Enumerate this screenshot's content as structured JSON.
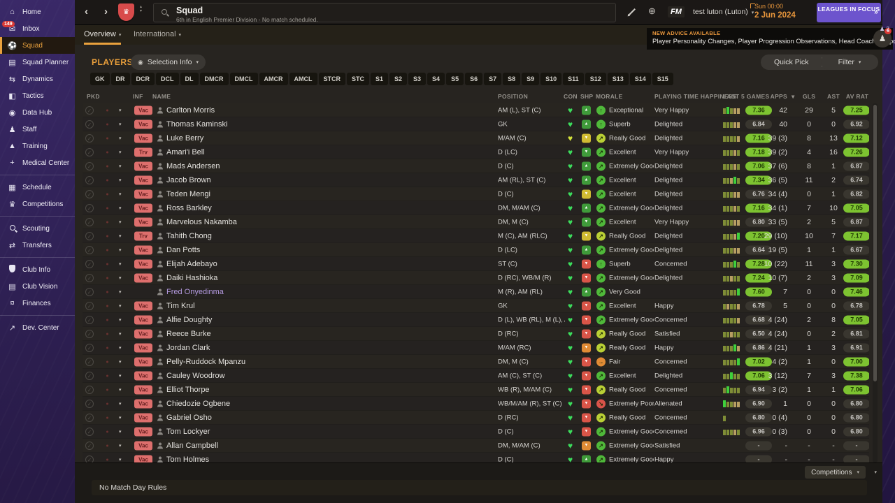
{
  "colors": {
    "accent_orange": "#e9a13d",
    "good_green": "#7dc331",
    "vac_red": "#de6f6d",
    "purple": "#6d54cd"
  },
  "sidebar": {
    "items": [
      {
        "label": "Home",
        "icon": "home-icon"
      },
      {
        "label": "Inbox",
        "icon": "inbox-icon",
        "badge": "149"
      },
      {
        "label": "Squad",
        "icon": "shirt-icon",
        "selected": true
      },
      {
        "label": "Squad Planner",
        "icon": "clipboard-icon"
      },
      {
        "label": "Dynamics",
        "icon": "dynamics-icon"
      },
      {
        "label": "Tactics",
        "icon": "tactics-icon"
      },
      {
        "label": "Data Hub",
        "icon": "data-hub-icon"
      },
      {
        "label": "Staff",
        "icon": "staff-icon"
      },
      {
        "label": "Training",
        "icon": "training-icon"
      },
      {
        "label": "Medical Center",
        "icon": "medical-icon"
      },
      {
        "label": "Schedule",
        "icon": "calendar-icon",
        "group_start": true
      },
      {
        "label": "Competitions",
        "icon": "trophy-icon"
      },
      {
        "label": "Scouting",
        "icon": "scouting-icon",
        "group_start": true
      },
      {
        "label": "Transfers",
        "icon": "transfers-icon"
      },
      {
        "label": "Club Info",
        "icon": "shield-icon",
        "group_start": true
      },
      {
        "label": "Club Vision",
        "icon": "briefcase-icon"
      },
      {
        "label": "Finances",
        "icon": "finances-icon"
      },
      {
        "label": "Dev. Center",
        "icon": "dev-center-icon",
        "group_start": true
      }
    ]
  },
  "topbar": {
    "title": "Squad",
    "subtitle": "6th in English Premier Division - No match scheduled.",
    "fm_label": "FM",
    "manager": "test luton (Luton)",
    "clock": "Sun 00:00",
    "date": "2 Jun 2024",
    "leagues_button": "LEAGUES IN FOCUS",
    "focus_count": "2"
  },
  "tabs": [
    {
      "label": "Overview"
    },
    {
      "label": "International"
    }
  ],
  "advice": {
    "headline": "NEW ADVICE AVAILABLE",
    "items": "Player Personality Changes, Player Progression Observations, Head Coach Support",
    "badge": "5"
  },
  "players_panel": {
    "title": "PLAYERS",
    "selection_info": "Selection Info",
    "quick_pick": "Quick Pick",
    "filter": "Filter",
    "position_filters": [
      "GK",
      "DR",
      "DCR",
      "DCL",
      "DL",
      "DMCR",
      "DMCL",
      "AMCR",
      "AMCL",
      "STCR",
      "STC",
      "S1",
      "S2",
      "S3",
      "S4",
      "S5",
      "S6",
      "S7",
      "S8",
      "S9",
      "S10",
      "S11",
      "S12",
      "S13",
      "S14",
      "S15"
    ]
  },
  "table": {
    "headers": {
      "pkd": "PKD",
      "inf": "INF",
      "name": "NAME",
      "position": "POSITION",
      "con": "CON",
      "shp": "SHP",
      "morale": "MORALE",
      "pth": "PLAYING TIME HAPPINESS",
      "last5": "LAST 5 GAMES",
      "apps": "APPS",
      "gls": "GLS",
      "ast": "AST",
      "avrat": "AV RAT"
    },
    "rows": [
      {
        "name": "Carlton Morris",
        "status": "Vac",
        "pos": "AM (L), ST (C)",
        "con": "green",
        "shp": {
          "c": "green",
          "d": "up"
        },
        "morale": {
          "label": "Exceptional",
          "color": "green",
          "arrow": "up"
        },
        "pth": "Very Happy",
        "bars": [
          "o",
          "g",
          "o",
          "t",
          "t"
        ],
        "r5": "7.36",
        "r5good": true,
        "apps": "42",
        "gls": "29",
        "ast": "5",
        "avrat": "7.25",
        "avgood": true
      },
      {
        "name": "Thomas Kaminski",
        "status": "Vac",
        "pos": "GK",
        "con": "green",
        "shp": {
          "c": "green",
          "d": "up"
        },
        "morale": {
          "label": "Superb",
          "color": "green",
          "arrow": "up"
        },
        "pth": "Delighted",
        "bars": [
          "o",
          "o",
          "o",
          "t",
          "t"
        ],
        "r5": "6.84",
        "r5good": false,
        "apps": "40",
        "gls": "0",
        "ast": "0",
        "avrat": "6.92",
        "avgood": false
      },
      {
        "name": "Luke Berry",
        "status": "Vac",
        "pos": "M/AM (C)",
        "con": "yellow",
        "shp": {
          "c": "yellow",
          "d": "down"
        },
        "morale": {
          "label": "Really Good",
          "color": "lime",
          "arrow": "ne"
        },
        "pth": "Delighted",
        "bars": [
          "o",
          "o",
          "o",
          "o",
          "t"
        ],
        "r5": "7.16",
        "r5good": true,
        "apps": "39 (3)",
        "gls": "8",
        "ast": "13",
        "avrat": "7.12",
        "avgood": true
      },
      {
        "name": "Amari'i Bell",
        "status": "Trv",
        "pos": "D (LC)",
        "con": "green",
        "shp": {
          "c": "green",
          "d": "down"
        },
        "morale": {
          "label": "Excellent",
          "color": "green",
          "arrow": "ne"
        },
        "pth": "Very Happy",
        "bars": [
          "o",
          "o",
          "o",
          "t",
          "o"
        ],
        "r5": "7.18",
        "r5good": true,
        "apps": "39 (2)",
        "gls": "4",
        "ast": "16",
        "avrat": "7.26",
        "avgood": true
      },
      {
        "name": "Mads Andersen",
        "status": "Vac",
        "pos": "D (C)",
        "con": "green",
        "shp": {
          "c": "green",
          "d": "up"
        },
        "morale": {
          "label": "Extremely Good",
          "color": "green",
          "arrow": "ne"
        },
        "pth": "Delighted",
        "bars": [
          "o",
          "o",
          "o",
          "t",
          "o"
        ],
        "r5": "7.06",
        "r5good": true,
        "apps": "37 (6)",
        "gls": "8",
        "ast": "1",
        "avrat": "6.87",
        "avgood": false
      },
      {
        "name": "Jacob Brown",
        "status": "Vac",
        "pos": "AM (RL), ST (C)",
        "con": "green",
        "shp": {
          "c": "green",
          "d": "up"
        },
        "morale": {
          "label": "Excellent",
          "color": "green",
          "arrow": "ne"
        },
        "pth": "Delighted",
        "bars": [
          "o",
          "o",
          "t",
          "g",
          "o"
        ],
        "r5": "7.34",
        "r5good": true,
        "apps": "36 (5)",
        "gls": "11",
        "ast": "2",
        "avrat": "6.74",
        "avgood": false
      },
      {
        "name": "Teden Mengi",
        "status": "Vac",
        "pos": "D (C)",
        "con": "green",
        "shp": {
          "c": "yellow",
          "d": "down"
        },
        "morale": {
          "label": "Excellent",
          "color": "green",
          "arrow": "ne"
        },
        "pth": "Delighted",
        "bars": [
          "o",
          "o",
          "o",
          "t",
          "t"
        ],
        "r5": "6.76",
        "r5good": false,
        "apps": "34 (4)",
        "gls": "0",
        "ast": "1",
        "avrat": "6.82",
        "avgood": false
      },
      {
        "name": "Ross Barkley",
        "status": "Vac",
        "pos": "DM, M/AM (C)",
        "con": "green",
        "shp": {
          "c": "green",
          "d": "up"
        },
        "morale": {
          "label": "Extremely Good",
          "color": "green",
          "arrow": "ne"
        },
        "pth": "Delighted",
        "bars": [
          "o",
          "o",
          "o",
          "t",
          "o"
        ],
        "r5": "7.16",
        "r5good": true,
        "apps": "34 (1)",
        "gls": "7",
        "ast": "10",
        "avrat": "7.05",
        "avgood": true
      },
      {
        "name": "Marvelous Nakamba",
        "status": "Vac",
        "pos": "DM, M (C)",
        "con": "green",
        "shp": {
          "c": "green",
          "d": "down"
        },
        "morale": {
          "label": "Excellent",
          "color": "green",
          "arrow": "ne"
        },
        "pth": "Very Happy",
        "bars": [
          "o",
          "o",
          "o",
          "t",
          "t"
        ],
        "r5": "6.80",
        "r5good": false,
        "apps": "33 (5)",
        "gls": "2",
        "ast": "5",
        "avrat": "6.87",
        "avgood": false
      },
      {
        "name": "Tahith Chong",
        "status": "Trv",
        "pos": "M (C), AM (RLC)",
        "con": "green",
        "shp": {
          "c": "yellow",
          "d": "down"
        },
        "morale": {
          "label": "Really Good",
          "color": "lime",
          "arrow": "ne"
        },
        "pth": "Delighted",
        "bars": [
          "o",
          "o",
          "o",
          "t",
          "g"
        ],
        "r5": "7.20",
        "r5good": true,
        "apps": "29 (10)",
        "gls": "10",
        "ast": "7",
        "avrat": "7.17",
        "avgood": true
      },
      {
        "name": "Dan Potts",
        "status": "Vac",
        "pos": "D (LC)",
        "con": "green",
        "shp": {
          "c": "green",
          "d": "up"
        },
        "morale": {
          "label": "Extremely Good",
          "color": "green",
          "arrow": "ne"
        },
        "pth": "Delighted",
        "bars": [
          "o",
          "o",
          "o",
          "t",
          "t"
        ],
        "r5": "6.64",
        "r5good": false,
        "apps": "19 (5)",
        "gls": "1",
        "ast": "1",
        "avrat": "6.67",
        "avgood": false
      },
      {
        "name": "Elijah Adebayo",
        "status": "Vac",
        "pos": "ST (C)",
        "con": "green",
        "shp": {
          "c": "red",
          "d": "down"
        },
        "morale": {
          "label": "Superb",
          "color": "green",
          "arrow": "up"
        },
        "pth": "Concerned",
        "bars": [
          "o",
          "o",
          "o",
          "g",
          "o"
        ],
        "r5": "7.28",
        "r5good": true,
        "apps": "10 (22)",
        "gls": "11",
        "ast": "3",
        "avrat": "7.30",
        "avgood": true
      },
      {
        "name": "Daiki Hashioka",
        "status": "Vac",
        "pos": "D (RC), WB/M (R)",
        "con": "green",
        "shp": {
          "c": "red",
          "d": "down"
        },
        "morale": {
          "label": "Extremely Good",
          "color": "green",
          "arrow": "ne"
        },
        "pth": "Delighted",
        "bars": [
          "o",
          "o",
          "t",
          "o",
          "o"
        ],
        "r5": "7.24",
        "r5good": true,
        "apps": "10 (7)",
        "gls": "2",
        "ast": "3",
        "avrat": "7.09",
        "avgood": true
      },
      {
        "name": "Fred Onyedinma",
        "status": "",
        "name_color": "#b49ae0",
        "pos": "M (R), AM (RL)",
        "con": "green",
        "shp": {
          "c": "green",
          "d": "up"
        },
        "morale": {
          "label": "Very Good",
          "color": "green",
          "arrow": "ne"
        },
        "pth": "",
        "bars": [
          "o",
          "o",
          "o",
          "o",
          "g"
        ],
        "r5": "7.60",
        "r5good": true,
        "apps": "7",
        "gls": "0",
        "ast": "0",
        "avrat": "7.46",
        "avgood": true
      },
      {
        "name": "Tim Krul",
        "status": "Vac",
        "pos": "GK",
        "con": "green",
        "shp": {
          "c": "red",
          "d": "down"
        },
        "morale": {
          "label": "Excellent",
          "color": "green",
          "arrow": "ne"
        },
        "pth": "Happy",
        "bars": [
          "o",
          "t",
          "o",
          "o",
          "t"
        ],
        "r5": "6.78",
        "r5good": false,
        "apps": "5",
        "gls": "0",
        "ast": "0",
        "avrat": "6.78",
        "avgood": false
      },
      {
        "name": "Alfie Doughty",
        "status": "Vac",
        "pos": "D (L), WB (RL), M (L), A...",
        "con": "green",
        "shp": {
          "c": "red",
          "d": "down"
        },
        "morale": {
          "label": "Extremely Good",
          "color": "green",
          "arrow": "ne"
        },
        "pth": "Concerned",
        "bars": [
          "o",
          "o",
          "o",
          "o",
          "t"
        ],
        "r5": "6.68",
        "r5good": false,
        "apps": "4 (24)",
        "gls": "2",
        "ast": "8",
        "avrat": "7.05",
        "avgood": true
      },
      {
        "name": "Reece Burke",
        "status": "Vac",
        "pos": "D (RC)",
        "con": "green",
        "shp": {
          "c": "red",
          "d": "down"
        },
        "morale": {
          "label": "Really Good",
          "color": "lime",
          "arrow": "ne"
        },
        "pth": "Satisfied",
        "bars": [
          "o",
          "o",
          "t",
          "o",
          "o"
        ],
        "r5": "6.50",
        "r5good": false,
        "apps": "4 (24)",
        "gls": "0",
        "ast": "2",
        "avrat": "6.81",
        "avgood": false
      },
      {
        "name": "Jordan Clark",
        "status": "Vac",
        "pos": "M/AM (RC)",
        "con": "green",
        "shp": {
          "c": "orange",
          "d": "down"
        },
        "morale": {
          "label": "Really Good",
          "color": "lime",
          "arrow": "ne"
        },
        "pth": "Happy",
        "bars": [
          "o",
          "o",
          "o",
          "g",
          "t"
        ],
        "r5": "6.86",
        "r5good": false,
        "apps": "4 (21)",
        "gls": "1",
        "ast": "3",
        "avrat": "6.91",
        "avgood": false
      },
      {
        "name": "Pelly-Ruddock Mpanzu",
        "status": "Vac",
        "pos": "DM, M (C)",
        "con": "green",
        "shp": {
          "c": "red",
          "d": "down"
        },
        "morale": {
          "label": "Fair",
          "color": "orange",
          "arrow": "e"
        },
        "pth": "Concerned",
        "bars": [
          "o",
          "o",
          "o",
          "o",
          "g"
        ],
        "r5": "7.02",
        "r5good": true,
        "apps": "4 (2)",
        "gls": "1",
        "ast": "0",
        "avrat": "7.00",
        "avgood": true
      },
      {
        "name": "Cauley Woodrow",
        "status": "Vac",
        "pos": "AM (C), ST (C)",
        "con": "green",
        "shp": {
          "c": "red",
          "d": "down"
        },
        "morale": {
          "label": "Excellent",
          "color": "green",
          "arrow": "ne"
        },
        "pth": "Delighted",
        "bars": [
          "o",
          "o",
          "g",
          "o",
          "o"
        ],
        "r5": "7.06",
        "r5good": true,
        "apps": "3 (12)",
        "gls": "7",
        "ast": "3",
        "avrat": "7.38",
        "avgood": true
      },
      {
        "name": "Elliot Thorpe",
        "status": "Vac",
        "pos": "WB (R), M/AM (C)",
        "con": "green",
        "shp": {
          "c": "red",
          "d": "down"
        },
        "morale": {
          "label": "Really Good",
          "color": "lime",
          "arrow": "ne"
        },
        "pth": "Concerned",
        "bars": [
          "o",
          "g",
          "o",
          "o",
          "o"
        ],
        "r5": "6.94",
        "r5good": false,
        "apps": "3 (2)",
        "gls": "1",
        "ast": "1",
        "avrat": "7.06",
        "avgood": true
      },
      {
        "name": "Chiedozie Ogbene",
        "status": "Vac",
        "pos": "WB/M/AM (R), ST (C)",
        "con": "green",
        "shp": {
          "c": "red",
          "d": "down"
        },
        "morale": {
          "label": "Extremely Poor",
          "color": "red",
          "arrow": "se"
        },
        "pth": "Alienated",
        "bars": [
          "g",
          "o",
          "o",
          "t",
          "t"
        ],
        "r5": "6.90",
        "r5good": false,
        "apps": "1",
        "gls": "0",
        "ast": "0",
        "avrat": "6.80",
        "avgood": false
      },
      {
        "name": "Gabriel Osho",
        "status": "Vac",
        "pos": "D (RC)",
        "con": "green",
        "shp": {
          "c": "red",
          "d": "down"
        },
        "morale": {
          "label": "Really Good",
          "color": "lime",
          "arrow": "ne"
        },
        "pth": "Concerned",
        "bars": [
          "o"
        ],
        "r5": "6.80",
        "r5good": false,
        "apps": "0 (4)",
        "gls": "0",
        "ast": "0",
        "avrat": "6.80",
        "avgood": false
      },
      {
        "name": "Tom Lockyer",
        "status": "Vac",
        "pos": "D (C)",
        "con": "green",
        "shp": {
          "c": "red",
          "d": "down"
        },
        "morale": {
          "label": "Extremely Good",
          "color": "green",
          "arrow": "ne"
        },
        "pth": "Concerned",
        "bars": [
          "o",
          "o",
          "o",
          "t",
          "o"
        ],
        "r5": "6.96",
        "r5good": false,
        "apps": "0 (3)",
        "gls": "0",
        "ast": "0",
        "avrat": "6.80",
        "avgood": false
      },
      {
        "name": "Allan Campbell",
        "status": "Vac",
        "pos": "DM, M/AM (C)",
        "con": "green",
        "shp": {
          "c": "orange",
          "d": "down"
        },
        "morale": {
          "label": "Extremely Good",
          "color": "green",
          "arrow": "ne"
        },
        "pth": "Satisfied",
        "bars": [],
        "r5": "-",
        "r5good": false,
        "apps": "-",
        "gls": "-",
        "ast": "-",
        "avrat": "-",
        "avgood": false
      },
      {
        "name": "Tom Holmes",
        "status": "Vac",
        "pos": "D (C)",
        "con": "green",
        "shp": {
          "c": "green",
          "d": "up"
        },
        "morale": {
          "label": "Extremely Good",
          "color": "green",
          "arrow": "ne"
        },
        "pth": "Happy",
        "bars": [],
        "r5": "-",
        "r5good": false,
        "apps": "-",
        "gls": "-",
        "ast": "-",
        "avrat": "-",
        "avgood": false
      }
    ]
  },
  "footer": {
    "note": "No Match Day Rules",
    "competitions": "Competitions"
  }
}
